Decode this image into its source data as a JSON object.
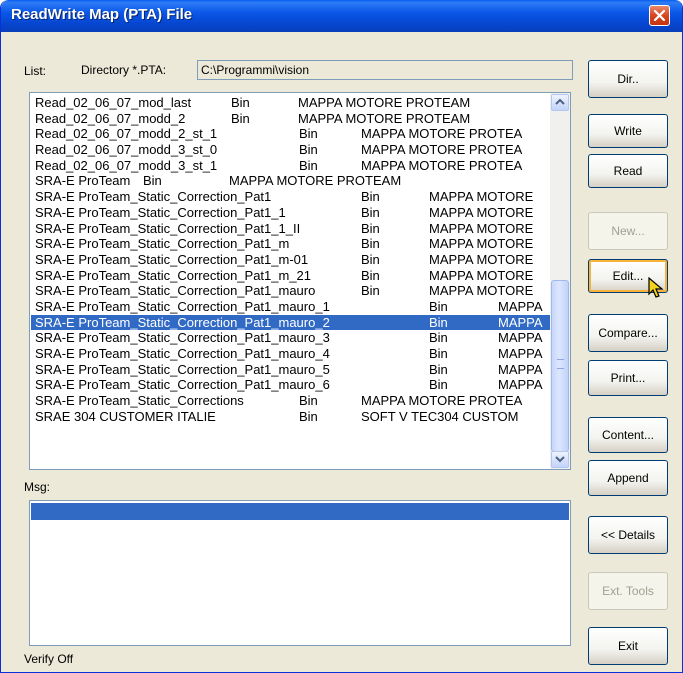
{
  "window": {
    "title": "ReadWrite Map (PTA) File"
  },
  "list_label": "List:",
  "directory": {
    "label": "Directory *.PTA:",
    "value": "C:\\Programmi\\vision"
  },
  "list": {
    "selected_index": 15,
    "rows": [
      {
        "name": "Read_02_06_07_mod_last",
        "type": "Bin",
        "desc": "MAPPA MOTORE PROTEAM"
      },
      {
        "name": "Read_02_06_07_modd_2",
        "type": "Bin",
        "desc": "MAPPA MOTORE PROTEAM"
      },
      {
        "name": "Read_02_06_07_modd_2_st_1",
        "type": "Bin",
        "desc": "MAPPA MOTORE PROTEA"
      },
      {
        "name": "Read_02_06_07_modd_3_st_0",
        "type": "Bin",
        "desc": "MAPPA MOTORE PROTEA"
      },
      {
        "name": "Read_02_06_07_modd_3_st_1",
        "type": "Bin",
        "desc": "MAPPA MOTORE PROTEA"
      },
      {
        "name": "SRA-E ProTeam",
        "type": "Bin",
        "desc": "MAPPA MOTORE PROTEAM"
      },
      {
        "name": "SRA-E ProTeam_Static_Correction_Pat1",
        "type": "Bin",
        "desc": "MAPPA MOTORE"
      },
      {
        "name": "SRA-E ProTeam_Static_Correction_Pat1_1",
        "type": "Bin",
        "desc": "MAPPA MOTORE"
      },
      {
        "name": "SRA-E ProTeam_Static_Correction_Pat1_1_II",
        "type": "Bin",
        "desc": "MAPPA MOTORE"
      },
      {
        "name": "SRA-E ProTeam_Static_Correction_Pat1_m",
        "type": "Bin",
        "desc": "MAPPA MOTORE"
      },
      {
        "name": "SRA-E ProTeam_Static_Correction_Pat1_m-01",
        "type": "Bin",
        "desc": "MAPPA MOTORE"
      },
      {
        "name": "SRA-E ProTeam_Static_Correction_Pat1_m_21",
        "type": "Bin",
        "desc": "MAPPA MOTORE"
      },
      {
        "name": "SRA-E ProTeam_Static_Correction_Pat1_mauro",
        "type": "Bin",
        "desc": "MAPPA MOTORE"
      },
      {
        "name": "SRA-E ProTeam_Static_Correction_Pat1_mauro_1",
        "type": "Bin",
        "desc": "MAPPA"
      },
      {
        "name": "SRA-E ProTeam_Static_Correction_Pat1_mauro_2",
        "type": "Bin",
        "desc": "MAPPA"
      },
      {
        "name": "SRA-E ProTeam_Static_Correction_Pat1_mauro_3",
        "type": "Bin",
        "desc": "MAPPA"
      },
      {
        "name": "SRA-E ProTeam_Static_Correction_Pat1_mauro_4",
        "type": "Bin",
        "desc": "MAPPA"
      },
      {
        "name": "SRA-E ProTeam_Static_Correction_Pat1_mauro_5",
        "type": "Bin",
        "desc": "MAPPA"
      },
      {
        "name": "SRA-E ProTeam_Static_Correction_Pat1_mauro_6",
        "type": "Bin",
        "desc": "MAPPA"
      },
      {
        "name": "SRA-E ProTeam_Static_Corrections",
        "type": "Bin",
        "desc": "MAPPA MOTORE PROTEA"
      },
      {
        "name": "SRAE  304  CUSTOMER  ITALIE",
        "type": "Bin",
        "desc": "SOFT V  TEC304 CUSTOM"
      }
    ]
  },
  "msg_label": "Msg:",
  "status": "Verify Off",
  "buttons": {
    "dir": "Dir..",
    "write": "Write",
    "read": "Read",
    "new": "New...",
    "edit": "Edit...",
    "compare": "Compare...",
    "print": "Print...",
    "content": "Content...",
    "append": "Append",
    "details": "<< Details",
    "ext_tools": "Ext. Tools",
    "exit": "Exit"
  },
  "colors": {
    "selection": "#316ac5",
    "title_bar": "#0a56e8",
    "dialog_bg": "#ece9d8"
  }
}
